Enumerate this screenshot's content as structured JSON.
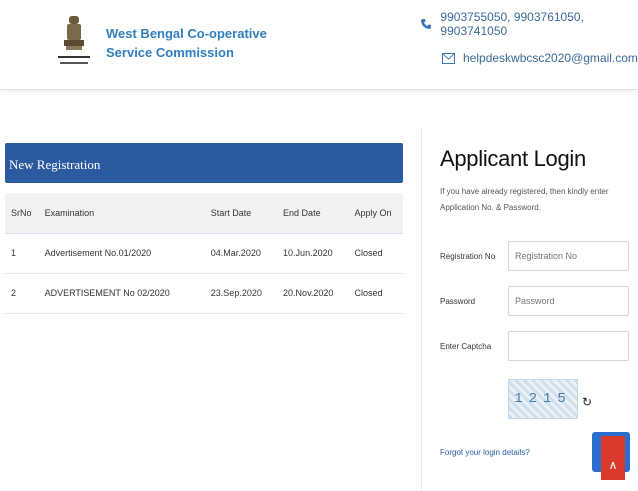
{
  "header": {
    "org_name": "West Bengal Co-operative Service Commission",
    "emblem_caption": "WEST BENGAL CO-OPERATIVE SERVICE COMMISSION",
    "phone": "9903755050, 9903761050, 9903741050",
    "email": "helpdeskwbcsc2020@gmail.com",
    "icons": {
      "phone": "phone-icon",
      "email": "envelope-icon"
    },
    "brand_color": "#2f7fc0"
  },
  "registration": {
    "title": "New Registration",
    "header_color": "#2c5aa0",
    "columns": [
      "SrNo",
      "Examination",
      "Start Date",
      "End Date",
      "Apply On"
    ],
    "rows": [
      [
        "1",
        "Advertisement No.01/2020",
        "04.Mar.2020",
        "10.Jun.2020",
        "Closed"
      ],
      [
        "2",
        "ADVERTISEMENT No 02/2020",
        "23.Sep.2020",
        "20.Nov.2020",
        "Closed"
      ]
    ]
  },
  "login": {
    "title": "Applicant Login",
    "hint": "If you have already registered, then kindly enter Application No. & Password.",
    "reg_label": "Registration No",
    "reg_placeholder": "Registration No",
    "password_label": "Password",
    "password_placeholder": "Password",
    "captcha_label": "Enter Captcha",
    "captcha_text": "1215",
    "refresh_icon": "refresh-icon",
    "forgot_link": "Forgot your login details?",
    "scroll_top_icon": "chevron-up-icon"
  }
}
